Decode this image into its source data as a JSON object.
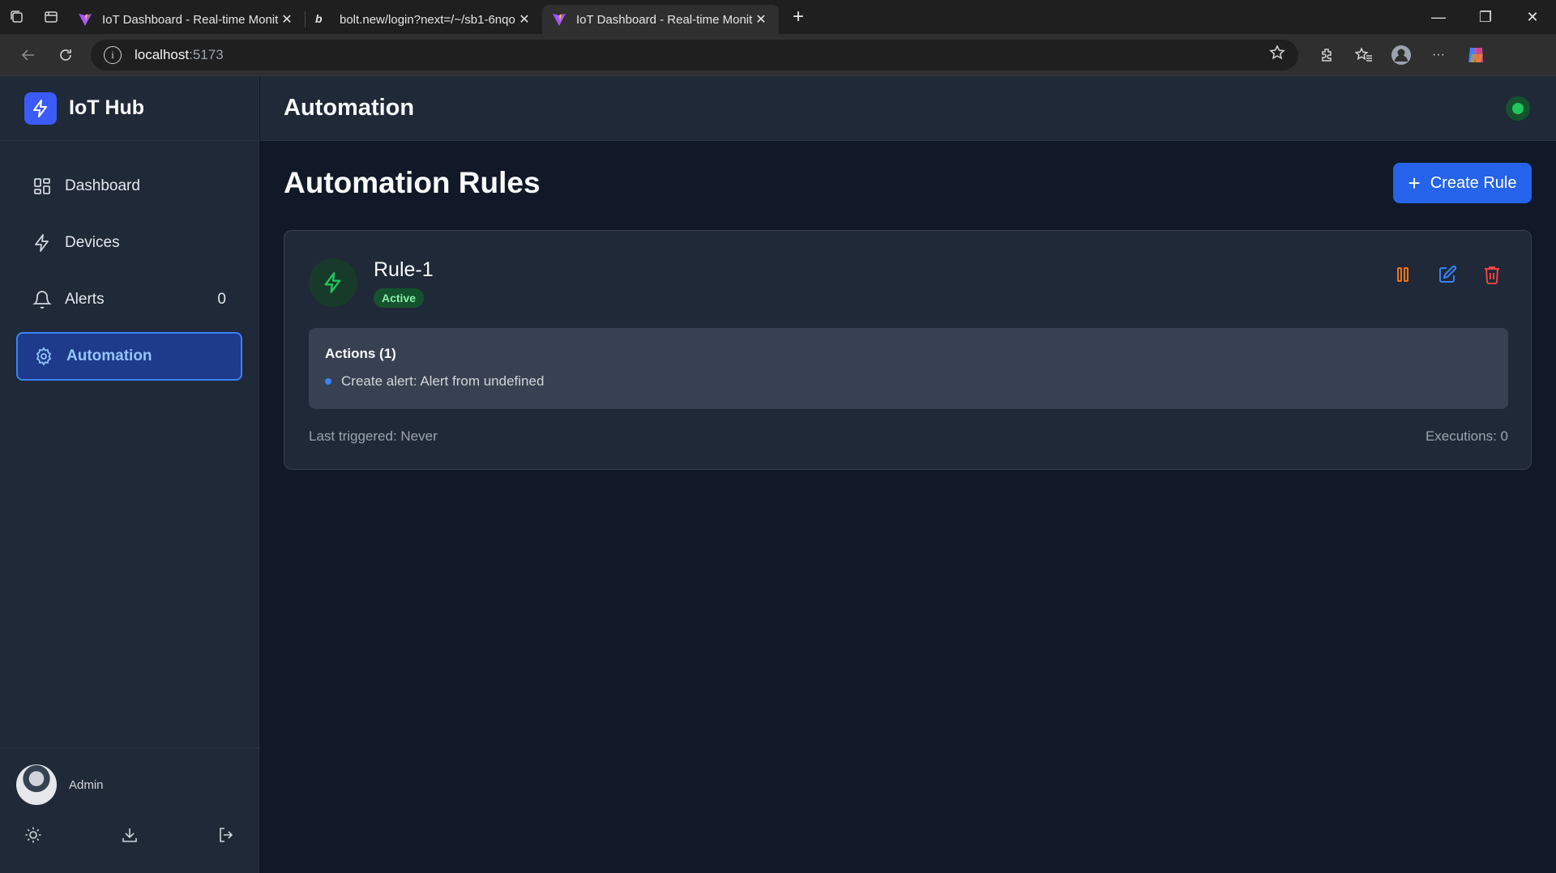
{
  "browser": {
    "tabs": [
      {
        "title": "IoT Dashboard - Real-time Monito",
        "active": false
      },
      {
        "title": "bolt.new/login?next=/~/sb1-6nqo",
        "active": false
      },
      {
        "title": "IoT Dashboard - Real-time Monito",
        "active": true
      }
    ],
    "url_host": "localhost",
    "url_port": ":5173"
  },
  "sidebar": {
    "brand": "IoT Hub",
    "items": [
      {
        "label": "Dashboard",
        "icon": "grid-icon"
      },
      {
        "label": "Devices",
        "icon": "zap-icon"
      },
      {
        "label": "Alerts",
        "icon": "bell-icon",
        "count": "0"
      },
      {
        "label": "Automation",
        "icon": "gear-icon",
        "active": true
      }
    ],
    "user": {
      "name": "Admin"
    }
  },
  "header": {
    "title": "Automation",
    "status_color": "#22c55e"
  },
  "main": {
    "title": "Automation Rules",
    "create_button": "Create Rule",
    "create_plus": "+",
    "rules": [
      {
        "name": "Rule-1",
        "status": "Active",
        "actions_title": "Actions (1)",
        "actions": [
          "Create alert: Alert from undefined"
        ],
        "last_triggered": "Last triggered: Never",
        "executions": "Executions: 0"
      }
    ]
  },
  "colors": {
    "accent": "#2563eb",
    "active_nav_bg": "#1e3a8a",
    "success": "#22c55e",
    "pause": "#f97316",
    "edit": "#3b82f6",
    "delete": "#ef4444"
  }
}
